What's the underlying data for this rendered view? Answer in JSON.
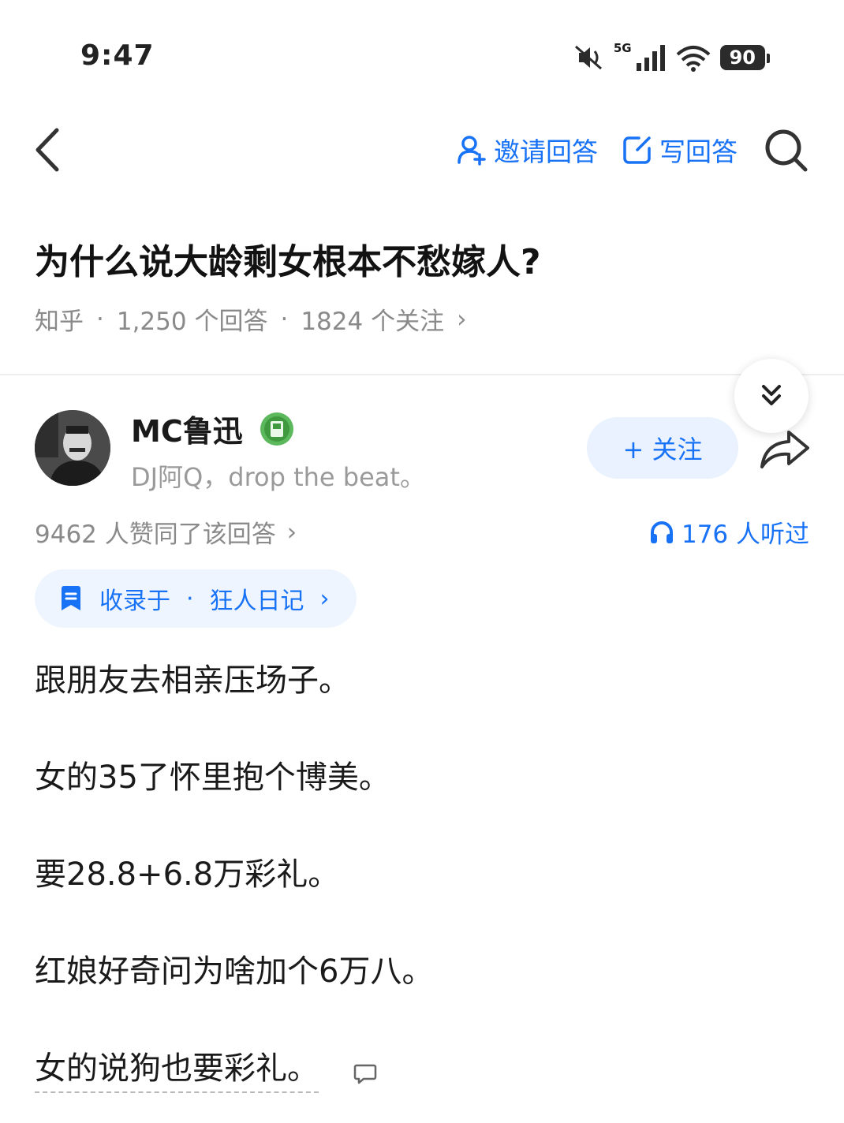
{
  "status_bar": {
    "time": "9:47",
    "network": "5G",
    "battery": "90",
    "icons": [
      "mute-icon",
      "signal-icon",
      "wifi-icon",
      "battery-icon"
    ]
  },
  "nav": {
    "invite_label": "邀请回答",
    "write_label": "写回答",
    "icons": [
      "back-icon",
      "invite-user-icon",
      "edit-icon",
      "search-icon"
    ]
  },
  "question": {
    "title": "为什么说大龄剩女根本不愁嫁人?",
    "source": "知乎",
    "answers": "1,250 个回答",
    "followers": "1824 个关注",
    "separator": "·",
    "chevron": "›"
  },
  "author": {
    "name": "MC鲁迅",
    "bio": "DJ阿Q，drop the beat。",
    "follow_label": "+ 关注"
  },
  "stats": {
    "votes": "9462 人赞同了该回答",
    "listens": "176 人听过"
  },
  "collection": {
    "label": "收录于",
    "separator": "·",
    "name": "狂人日记"
  },
  "content": {
    "paragraphs": [
      "跟朋友去相亲压场子。",
      "女的35了怀里抱个博美。",
      "要28.8+6.8万彩礼。",
      "红娘好奇问为啥加个6万八。",
      "女的说狗也要彩礼。"
    ]
  },
  "colors": {
    "accent": "#1772f6",
    "muted": "#8a8a8a",
    "text": "#1a1a1a"
  }
}
